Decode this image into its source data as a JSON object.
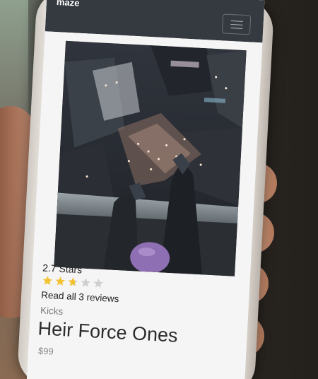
{
  "navbar": {
    "brand": "maze"
  },
  "product": {
    "rating_text": "2.7 Stars",
    "rating_value": 2.7,
    "rating_max": 5,
    "reviews_link": "Read all 3 reviews",
    "category": "Kicks",
    "title": "Heir Force Ones",
    "price": "$99"
  },
  "colors": {
    "navbar": "#343a40",
    "star_filled": "#f2c230",
    "star_empty": "#cfcfcf"
  },
  "icons": {
    "menu": "hamburger-menu-icon",
    "star": "star-icon"
  }
}
